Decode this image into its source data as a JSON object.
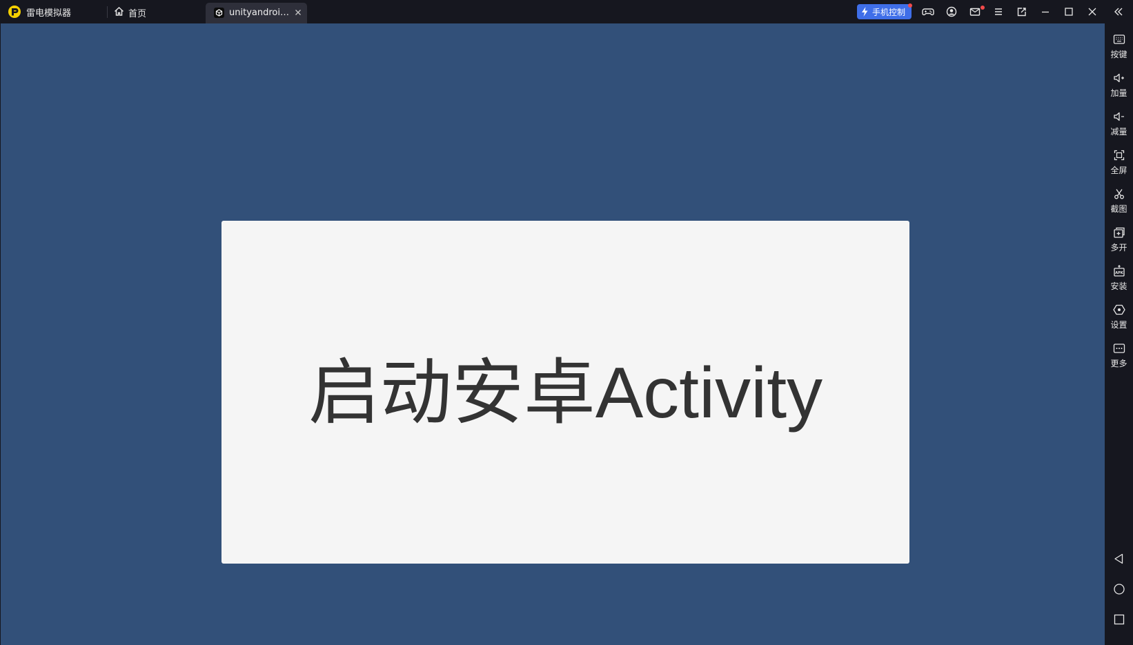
{
  "titlebar": {
    "app_name": "雷电模拟器",
    "home_tab_label": "首页",
    "app_tab_label": "unityandroidt...",
    "phone_control_label": "手机控制",
    "colors": {
      "background": "#16171f",
      "active_tab": "#2e2f3a",
      "accent": "#3f6ee8",
      "logo": "#f5d000",
      "notify_dot": "#f24a4a"
    },
    "icons": [
      "gamepad-icon",
      "user-icon",
      "mail-icon",
      "menu-icon",
      "window-sync-icon",
      "minimize-icon",
      "maximize-icon",
      "close-icon",
      "collapse-sidebar-icon"
    ]
  },
  "emulator": {
    "background": "#325079",
    "dialog_text": "启动安卓Activity"
  },
  "sidebar": {
    "items": [
      {
        "label": "按键",
        "icon": "keyboard-icon"
      },
      {
        "label": "加量",
        "icon": "volume-up-icon"
      },
      {
        "label": "减量",
        "icon": "volume-down-icon"
      },
      {
        "label": "全屏",
        "icon": "fullscreen-icon"
      },
      {
        "label": "截图",
        "icon": "scissors-icon"
      },
      {
        "label": "多开",
        "icon": "multi-instance-icon"
      },
      {
        "label": "安装",
        "icon": "apk-install-icon"
      },
      {
        "label": "设置",
        "icon": "settings-icon"
      },
      {
        "label": "更多",
        "icon": "more-icon"
      }
    ],
    "nav": [
      "back-icon",
      "home-icon",
      "recent-apps-icon"
    ]
  }
}
